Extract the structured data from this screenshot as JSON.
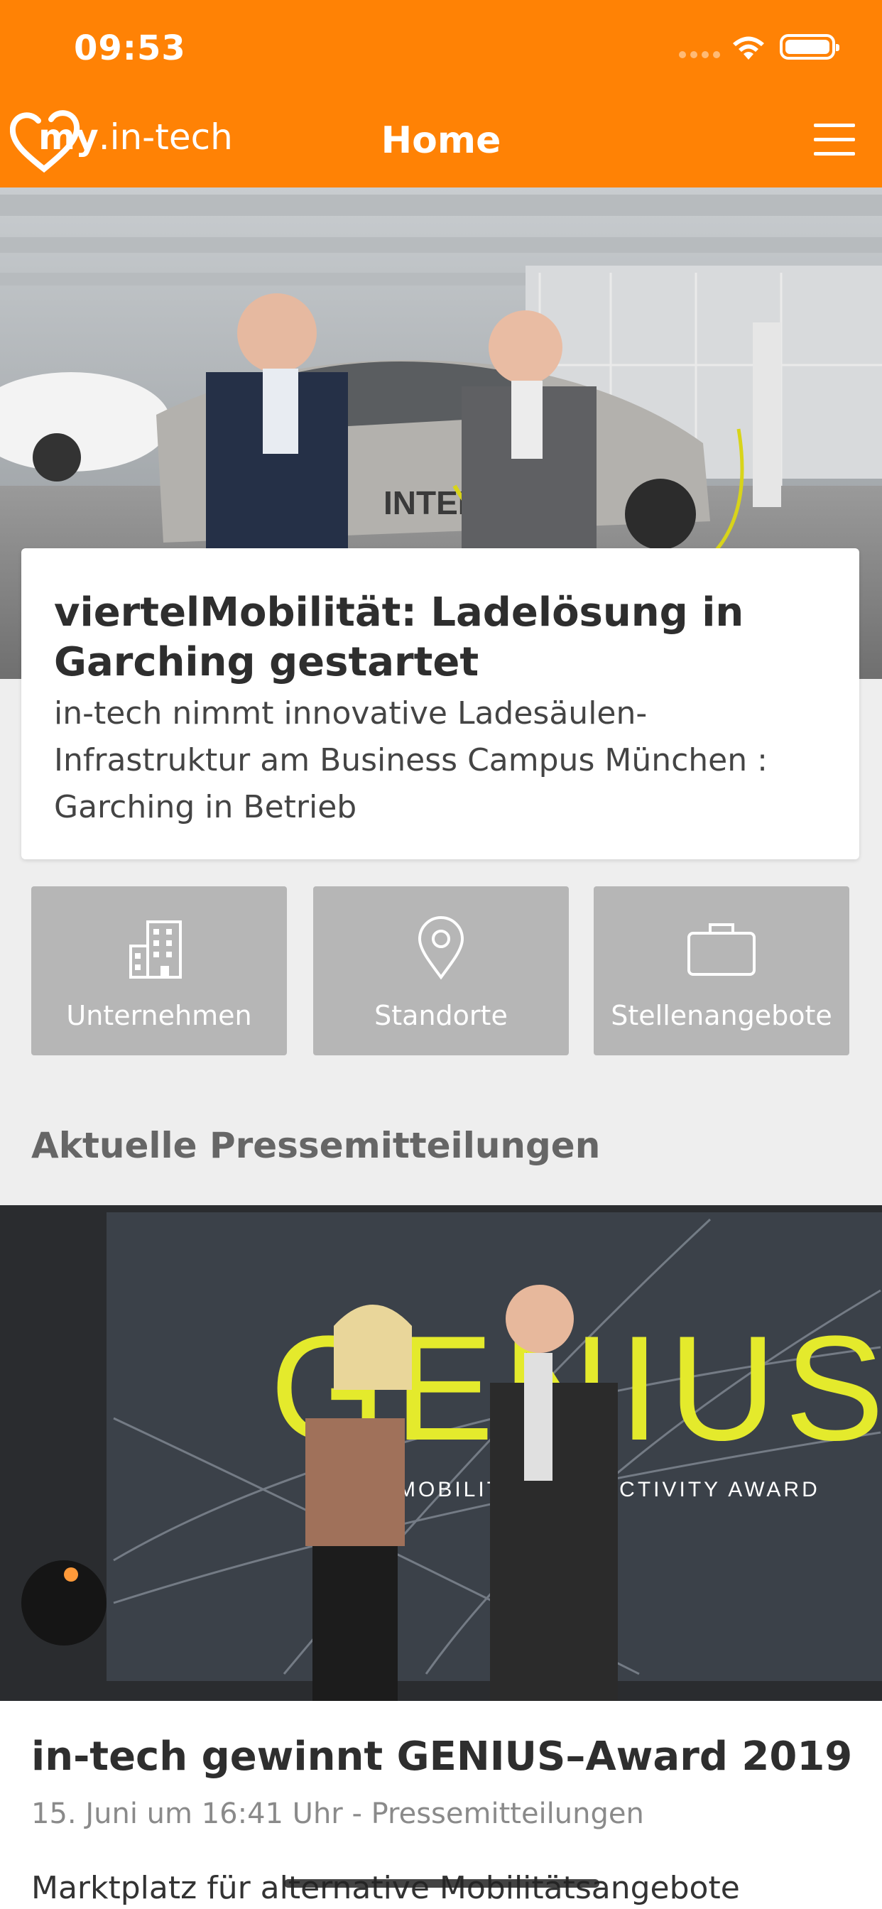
{
  "status_bar": {
    "time": "09:53"
  },
  "nav": {
    "logo_my": "my",
    "logo_rest": ".in-tech",
    "title": "Home"
  },
  "hero": {
    "headline": "viertelMobilität: Ladelösung in Garching gestartet",
    "subtitle": "in-tech nimmt innovative Ladesäulen-Infrastruktur am Business Campus München : Garching in Betrieb",
    "car_lettering": "INTEL"
  },
  "tiles": [
    {
      "label": "Unternehmen",
      "icon": "building-icon"
    },
    {
      "label": "Standorte",
      "icon": "location-pin-icon"
    },
    {
      "label": "Stellenangebote",
      "icon": "briefcase-icon"
    }
  ],
  "section_title": "Aktuelle Pressemitteilungen",
  "news": {
    "image_text": "GENIUS",
    "image_subtext": "MOBILITY CONNECTIVITY AWARD",
    "title": "in-tech gewinnt GENIUS–Award 2019",
    "meta": "15. Juni um 16:41 Uhr - Pressemitteilungen",
    "snippet": "Marktplatz für alternative Mobilitätsangebote"
  },
  "colors": {
    "brand": "#ff8205",
    "tile": "#b6b6b6",
    "background": "#eeeeee"
  }
}
